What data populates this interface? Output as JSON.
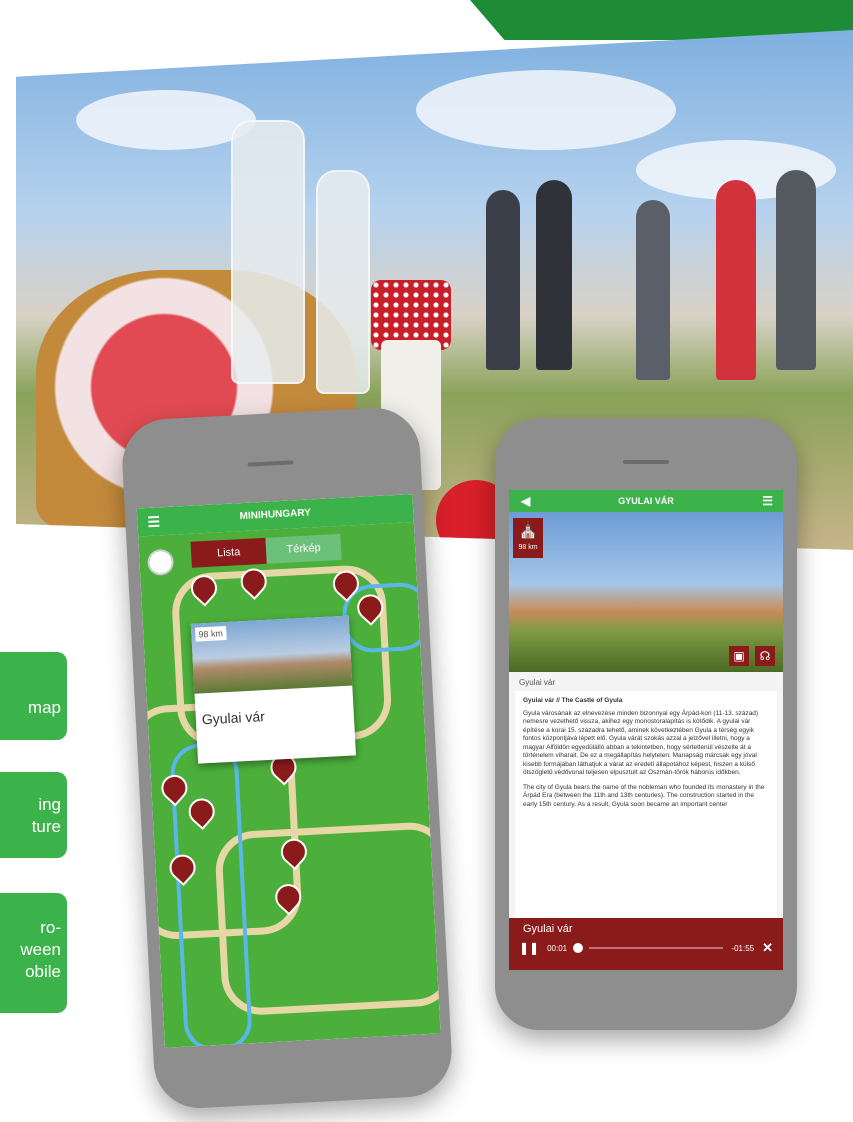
{
  "banner": {
    "alt": "photo"
  },
  "side_tabs": [
    {
      "label": "map"
    },
    {
      "label": "ing\nture"
    },
    {
      "label": "ro-\nween\nobile"
    }
  ],
  "phone1": {
    "title": "MINIHUNGARY",
    "seg_list": "Lista",
    "seg_map": "Térkép",
    "card_distance": "98 km",
    "card_title": "Gyulai vár"
  },
  "phone2": {
    "title": "GYULAI VÁR",
    "badge_distance": "98 km",
    "subtitle": "Gyulai vár",
    "article_title": "Gyulai vár // The Castle of Gyula",
    "paragraph_hu": "Gyula városának az elnevezése minden bizonnyal egy Árpád-kori (11-13. század) nemesre vezethető vissza, akihez egy monostoralapítás is kötődik. A gyulai vár építése a korai 15. századra tehető, aminek következtében Gyula a térség egyik fontos központjává lépett elő. Gyula várát szokás azzal a jelzővel illetni, hogy a magyar Alföldön egyedülálló abban a tekintetben, hogy sértetlenül vészelte át a történelem viharait. De ez a megállapítás helytelen: Manapság márcsak egy jóval kisebb formájában láthatjuk a várat az eredeti állapotához képest, hiszen a külső ötszögletű védővonal teljesen elpusztult az Oszmán-török háborús időkben.",
    "paragraph_en": "The city of Gyula bears the name of the nobleman who founded its monastery in the Árpád Era (between the 11th and 13th centuries). The construction started in the early 15th century. As a result, Gyula soon became an important center",
    "player_title": "Gyulai vár",
    "time_elapsed": "00:01",
    "time_remaining": "-01:55"
  },
  "colors": {
    "green": "#3cb34a",
    "dark_green": "#1e8b37",
    "maroon": "#8b1a1a"
  }
}
